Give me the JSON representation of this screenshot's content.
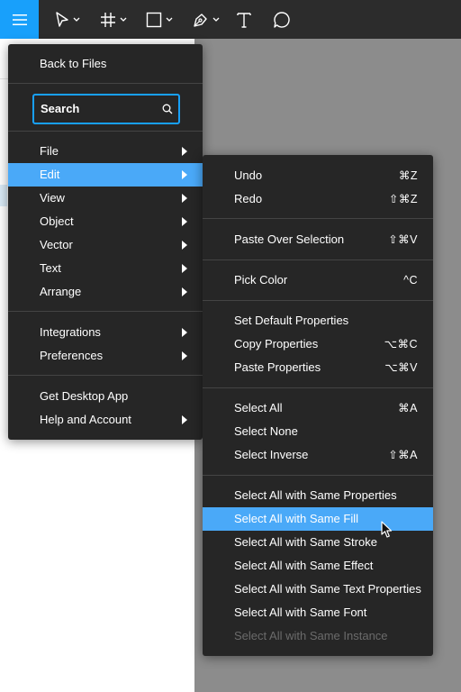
{
  "toolbar": {
    "tools": [
      {
        "name": "main-menu-icon"
      },
      {
        "name": "move-tool-icon"
      },
      {
        "name": "frame-tool-icon"
      },
      {
        "name": "shape-tool-icon"
      },
      {
        "name": "pen-tool-icon"
      },
      {
        "name": "text-tool-icon"
      },
      {
        "name": "comment-tool-icon"
      }
    ],
    "accent": "#18a0fb"
  },
  "main_menu": {
    "back_label": "Back to Files",
    "search_placeholder": "Search",
    "items": [
      {
        "label": "File",
        "submenu": true
      },
      {
        "label": "Edit",
        "submenu": true,
        "highlighted": true
      },
      {
        "label": "View",
        "submenu": true
      },
      {
        "label": "Object",
        "submenu": true
      },
      {
        "label": "Vector",
        "submenu": true
      },
      {
        "label": "Text",
        "submenu": true
      },
      {
        "label": "Arrange",
        "submenu": true
      },
      {
        "label": "Integrations",
        "submenu": true
      },
      {
        "label": "Preferences",
        "submenu": true
      },
      {
        "label": "Get Desktop App",
        "submenu": false
      },
      {
        "label": "Help and Account",
        "submenu": true
      }
    ]
  },
  "edit_menu": {
    "items": [
      {
        "label": "Undo",
        "shortcut": "⌘Z"
      },
      {
        "label": "Redo",
        "shortcut": "⇧⌘Z"
      },
      {
        "label": "Paste Over Selection",
        "shortcut": "⇧⌘V"
      },
      {
        "label": "Pick Color",
        "shortcut": "^C"
      },
      {
        "label": "Set Default Properties",
        "shortcut": ""
      },
      {
        "label": "Copy Properties",
        "shortcut": "⌥⌘C"
      },
      {
        "label": "Paste Properties",
        "shortcut": "⌥⌘V"
      },
      {
        "label": "Select All",
        "shortcut": "⌘A"
      },
      {
        "label": "Select None",
        "shortcut": ""
      },
      {
        "label": "Select Inverse",
        "shortcut": "⇧⌘A"
      },
      {
        "label": "Select All with Same Properties",
        "shortcut": ""
      },
      {
        "label": "Select All with Same Fill",
        "shortcut": "",
        "highlighted": true
      },
      {
        "label": "Select All with Same Stroke",
        "shortcut": ""
      },
      {
        "label": "Select All with Same Effect",
        "shortcut": ""
      },
      {
        "label": "Select All with Same Text Properties",
        "shortcut": ""
      },
      {
        "label": "Select All with Same Font",
        "shortcut": ""
      },
      {
        "label": "Select All with Same Instance",
        "shortcut": "",
        "disabled": true
      }
    ]
  }
}
